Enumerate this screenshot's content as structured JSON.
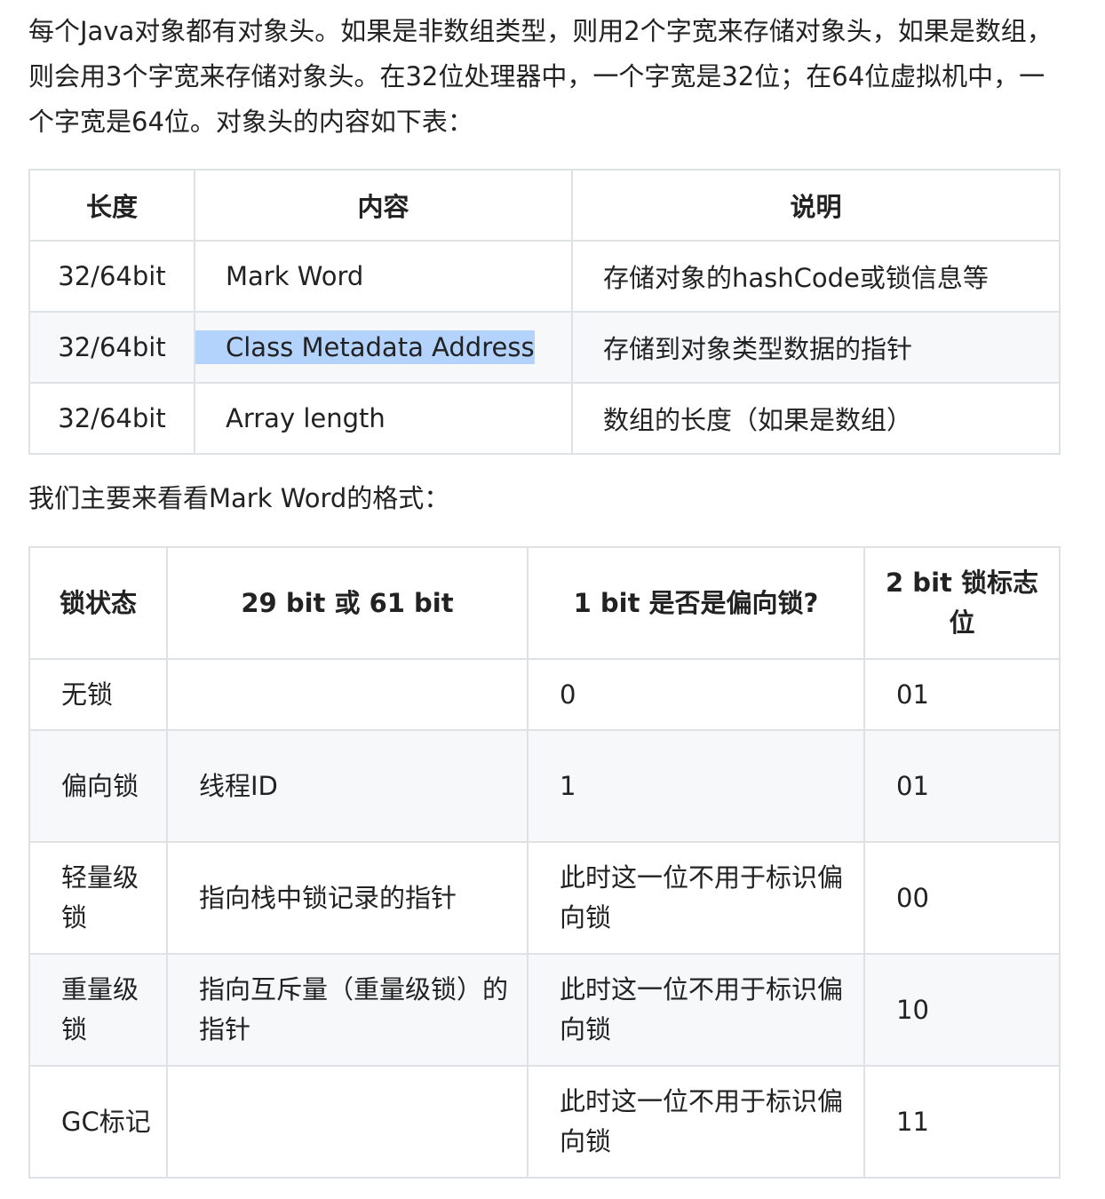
{
  "intro": "每个Java对象都有对象头。如果是非数组类型，则用2个字宽来存储对象头，如果是数组，则会用3个字宽来存储对象头。在32位处理器中，一个字宽是32位；在64位虚拟机中，一个字宽是64位。对象头的内容如下表：",
  "header_table": {
    "headers": [
      "长度",
      "内容",
      "说明"
    ],
    "rows": [
      {
        "length": "32/64bit",
        "content": "Mark Word",
        "desc": "存储对象的hashCode或锁信息等"
      },
      {
        "length": "32/64bit",
        "content": "Class Metadata Address",
        "desc": "存储到对象类型数据的指针"
      },
      {
        "length": "32/64bit",
        "content": "Array length",
        "desc": "数组的长度（如果是数组）"
      }
    ]
  },
  "mark_intro": "我们主要来看看Mark Word的格式：",
  "mark_table": {
    "headers": [
      "锁状态",
      "29 bit 或 61 bit",
      "1 bit 是否是偏向锁?",
      "2 bit 锁标志位"
    ],
    "rows": [
      {
        "state": "无锁",
        "bits": "",
        "biased": "0",
        "flag": "01"
      },
      {
        "state": "偏向锁",
        "bits": "线程ID",
        "biased": "1",
        "flag": "01"
      },
      {
        "state": "轻量级锁",
        "bits": "指向栈中锁记录的指针",
        "biased": "此时这一位不用于标识偏向锁",
        "flag": "00"
      },
      {
        "state": "重量级锁",
        "bits": "指向互斥量（重量级锁）的指针",
        "biased": "此时这一位不用于标识偏向锁",
        "flag": "10"
      },
      {
        "state": "GC标记",
        "bits": "",
        "biased": "此时这一位不用于标识偏向锁",
        "flag": "11"
      }
    ]
  },
  "colors": {
    "border": "#dfe2e5",
    "alt_row": "#f6f8fa",
    "selection": "#b3d3fc",
    "text": "#222222"
  }
}
